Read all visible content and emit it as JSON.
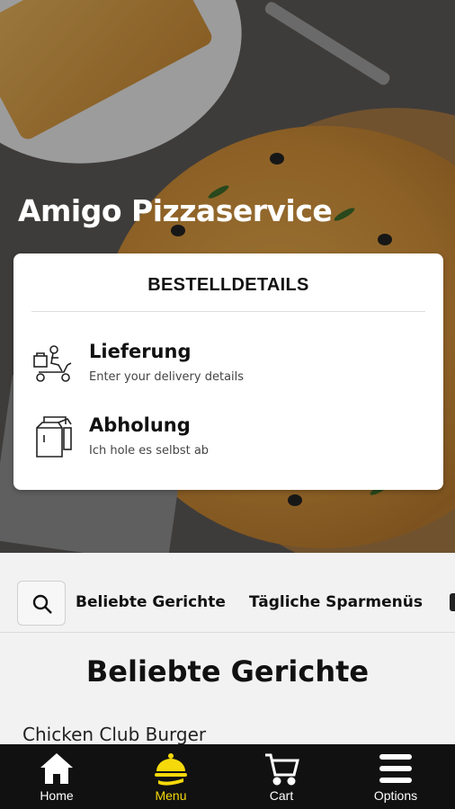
{
  "brand": {
    "title": "Amigo Pizzaservice"
  },
  "order_card": {
    "title": "BESTELLDETAILS",
    "options": [
      {
        "title": "Lieferung",
        "subtitle": "Enter your delivery details",
        "icon": "delivery-scooter-icon"
      },
      {
        "title": "Abholung",
        "subtitle": "Ich hole es selbst ab",
        "icon": "pickup-bag-icon"
      }
    ]
  },
  "categories": {
    "search_icon": "search-icon",
    "items": [
      "Beliebte Gerichte",
      "Tägliche Sparmenüs"
    ]
  },
  "section": {
    "title": "Beliebte Gerichte"
  },
  "menu_items": [
    {
      "name": "Chicken Club Burger"
    }
  ],
  "bottom_nav": {
    "active_color": "#f5d90a",
    "items": [
      {
        "label": "Home",
        "icon": "home-icon"
      },
      {
        "label": "Menu",
        "icon": "serving-dish-icon"
      },
      {
        "label": "Cart",
        "icon": "cart-icon"
      },
      {
        "label": "Options",
        "icon": "menu-lines-icon"
      }
    ]
  }
}
